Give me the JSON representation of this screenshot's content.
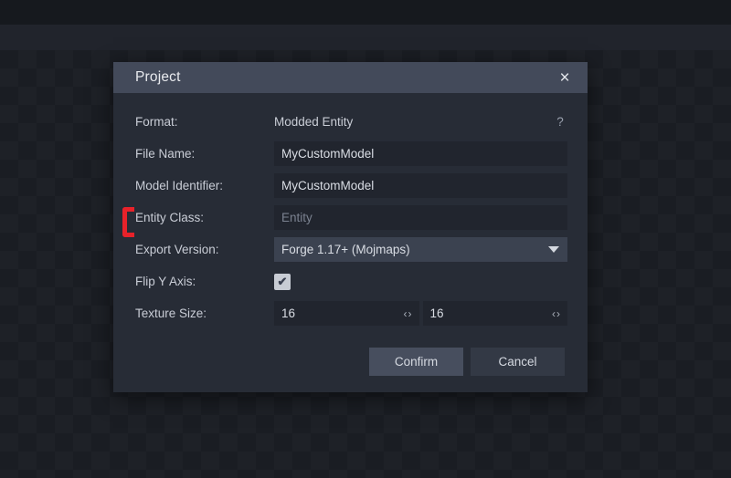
{
  "dialog": {
    "title": "Project",
    "close_icon": "×",
    "rows": [
      {
        "label": "Format:",
        "kind": "static",
        "value": "Modded Entity",
        "help": "?"
      },
      {
        "label": "File Name:",
        "kind": "text",
        "value": "MyCustomModel",
        "placeholder": ""
      },
      {
        "label": "Model Identifier:",
        "kind": "text",
        "value": "MyCustomModel",
        "placeholder": ""
      },
      {
        "label": "Entity Class:",
        "kind": "text",
        "value": "",
        "placeholder": "Entity"
      },
      {
        "label": "Export Version:",
        "kind": "select",
        "value": "Forge 1.17+ (Mojmaps)"
      },
      {
        "label": "Flip Y Axis:",
        "kind": "checkbox",
        "checked": true,
        "tick": "✔"
      },
      {
        "label": "Texture Size:",
        "kind": "numeric-pair",
        "value_x": "16",
        "value_y": "16",
        "stepper": "‹›"
      }
    ],
    "buttons": {
      "confirm": "Confirm",
      "cancel": "Cancel"
    }
  },
  "annotation": {
    "color": "#e8222a",
    "target": "Entity Class:"
  },
  "theme": {
    "titlebar": "#434a5a",
    "dialog_bg": "#272c36",
    "input_bg": "#21252e",
    "select_bg": "#3b4250",
    "text": "#d9dde4",
    "placeholder": "#7b8290",
    "accent_red": "#e8222a"
  }
}
